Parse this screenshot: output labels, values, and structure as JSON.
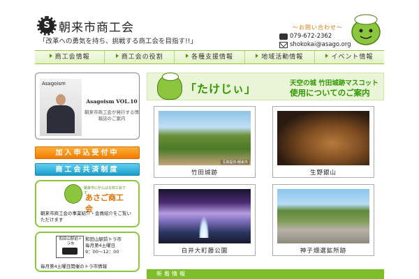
{
  "header": {
    "logo_glyph": "S",
    "site_title": "朝来市商工会",
    "tagline": "「改革への勇気を持ち、挑戦する商工会を目指す!!」",
    "contact": {
      "title": "～お問い合わせ～",
      "phone": "079-672-2362",
      "email": "shokokai@asago.org"
    }
  },
  "nav": {
    "items": [
      "商工会情報",
      "商工会の役割",
      "各種支援情報",
      "地域活動情報",
      "イベント情報"
    ]
  },
  "sidebar": {
    "magazine": {
      "brand": "Asagoism",
      "title": "Asagoism VOL.10",
      "text": "朝来市商工会が発行する情報誌のご案内"
    },
    "join_button": "加入申込受付中",
    "mutual_aid_button": "商工会共済制度",
    "card1": {
      "logo_small": "朝来市にがんばる商工会です",
      "logo_text": "あさご商工会",
      "text": "朝来市商工会の事業紹介・会員紹介をご覧いただけます"
    },
    "card2": {
      "icon_label": "和田山駅前トラ市",
      "info_line1": "和田山駅前トラ市",
      "info_line2": "毎月第4土曜日",
      "info_line3": "9：00～12：00",
      "text": "毎月第4土曜日開催のトラ市情報"
    }
  },
  "main": {
    "banner": {
      "name": "「たけじぃ」",
      "sub1": "天空の城 竹田城跡マスコット",
      "sub2": "使用についてのご案内"
    },
    "tiles": [
      {
        "caption": "竹田城跡",
        "tag": "写真提供:朝来市"
      },
      {
        "caption": "生野銀山",
        "tag": ""
      },
      {
        "caption": "白井大町藤公園",
        "tag": ""
      },
      {
        "caption": "神子畑選鉱所跡",
        "tag": ""
      }
    ]
  },
  "footer": {
    "title": "新着情報"
  },
  "colors": {
    "brand_green": "#8cc63f",
    "dark_green": "#2f9a00",
    "orange": "#f07c00",
    "blue": "#1c9ccb"
  }
}
